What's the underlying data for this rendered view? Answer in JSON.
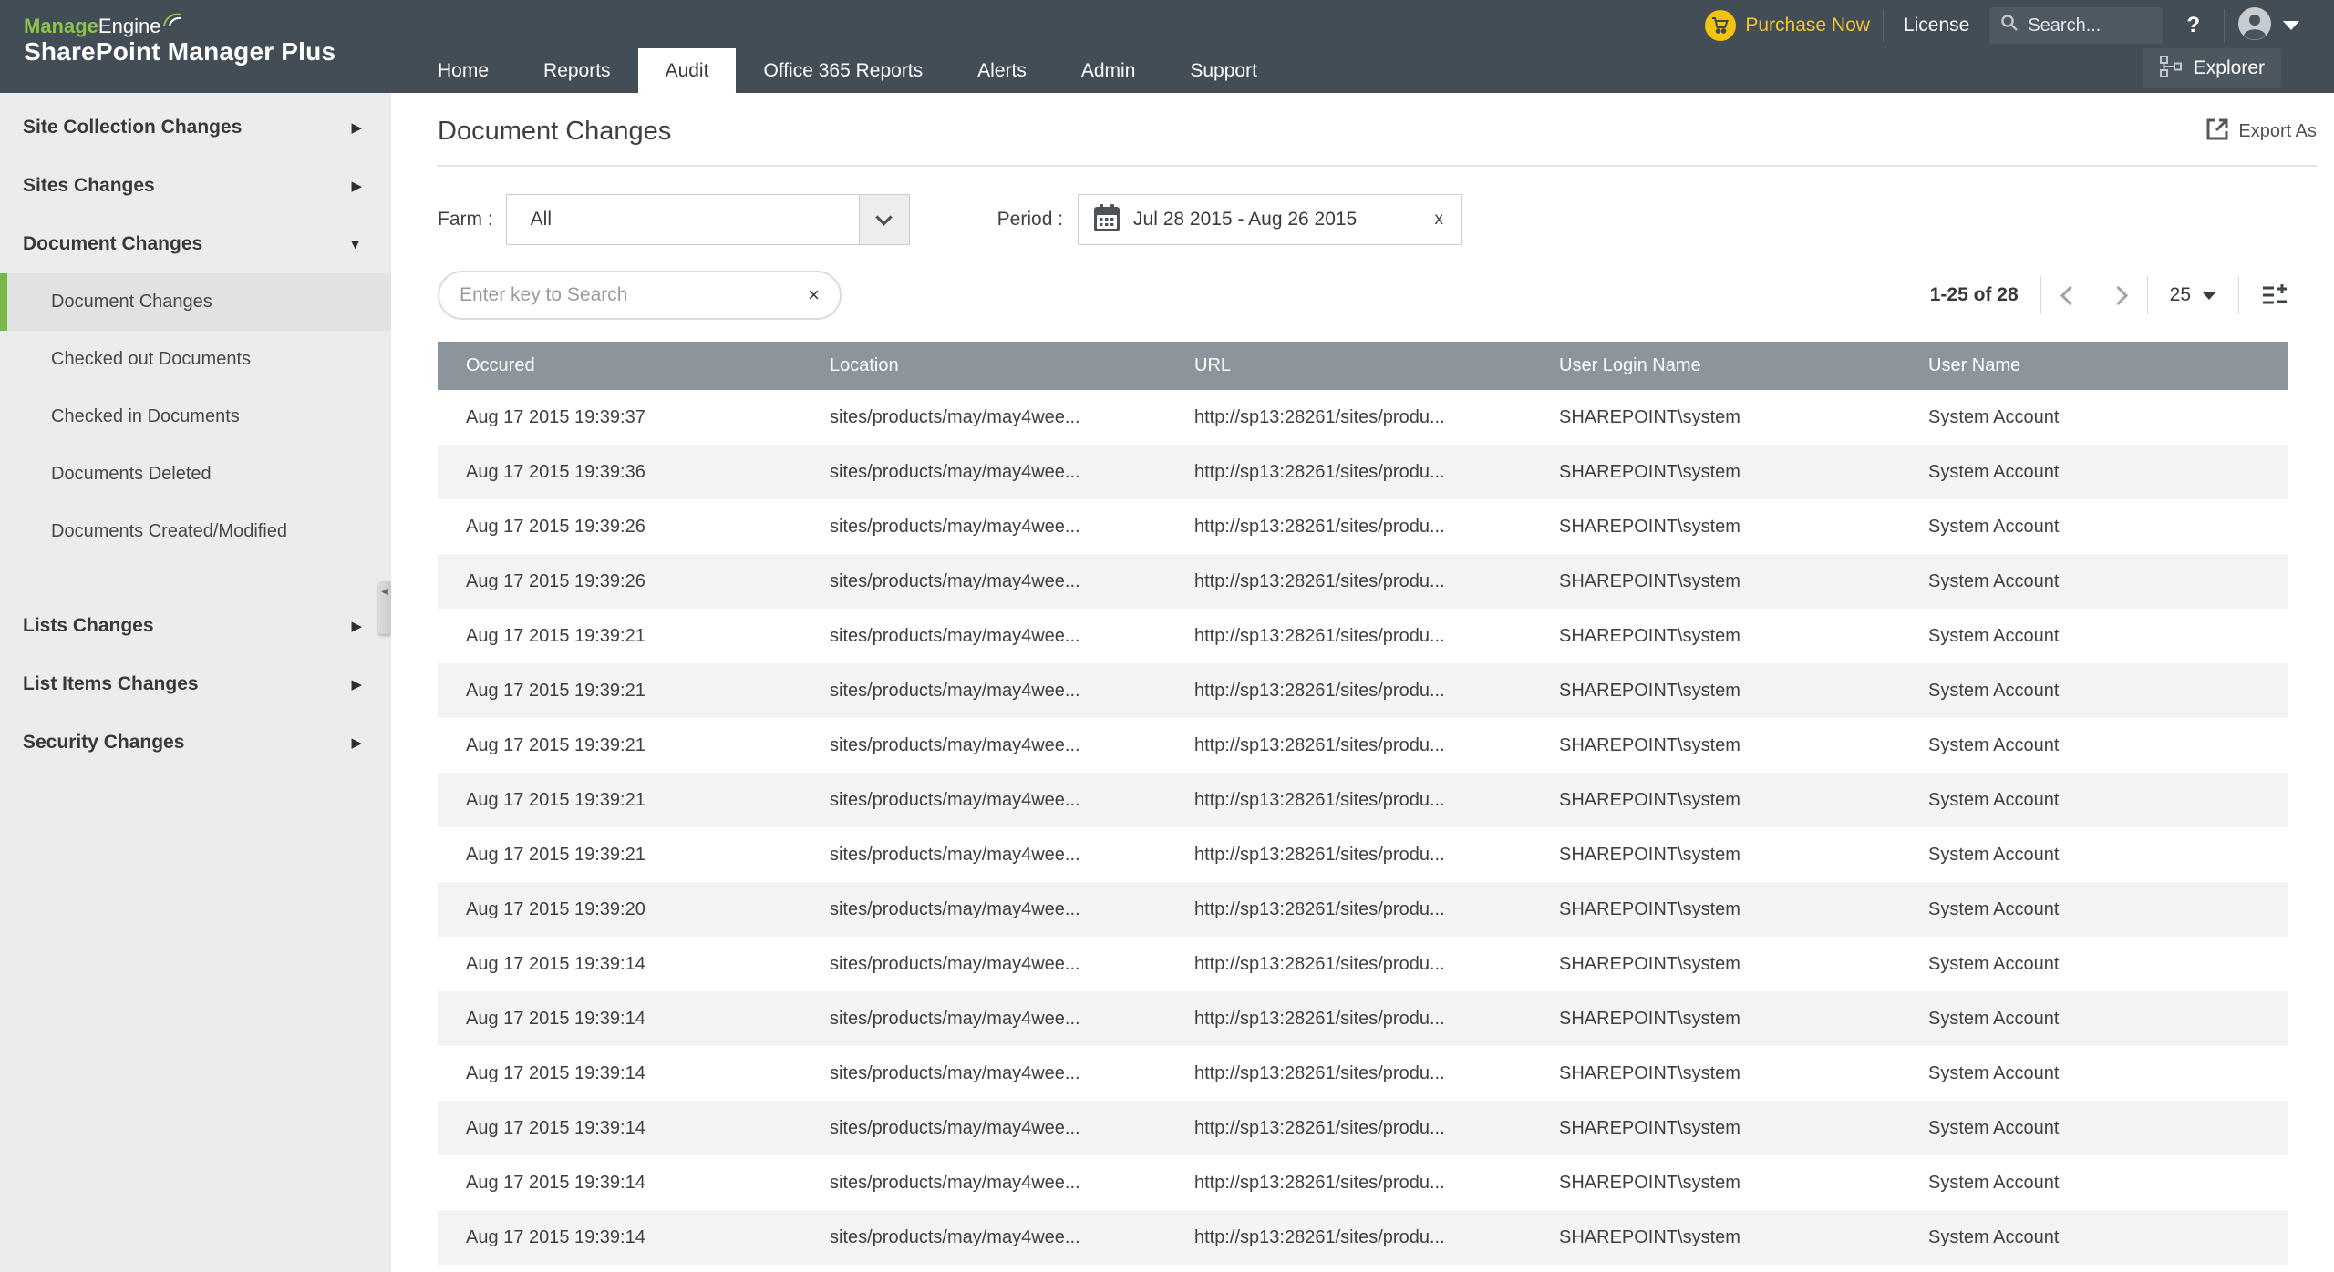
{
  "header": {
    "brand": {
      "manage": "Manage",
      "engine": "Engine",
      "product": "SharePoint Manager Plus"
    },
    "utility": {
      "purchase_label": "Purchase Now",
      "license_label": "License",
      "search_placeholder": "Search...",
      "help_label": "?"
    },
    "nav": [
      {
        "label": "Home",
        "active": false
      },
      {
        "label": "Reports",
        "active": false
      },
      {
        "label": "Audit",
        "active": true
      },
      {
        "label": "Office 365 Reports",
        "active": false
      },
      {
        "label": "Alerts",
        "active": false
      },
      {
        "label": "Admin",
        "active": false
      },
      {
        "label": "Support",
        "active": false
      }
    ],
    "explorer_label": "Explorer"
  },
  "sidebar": {
    "items": [
      {
        "label": "Site Collection Changes",
        "type": "group",
        "state": "collapsed"
      },
      {
        "label": "Sites Changes",
        "type": "group",
        "state": "collapsed"
      },
      {
        "label": "Document Changes",
        "type": "group",
        "state": "expanded"
      },
      {
        "label": "Document Changes",
        "type": "child",
        "selected": true
      },
      {
        "label": "Checked out Documents",
        "type": "child",
        "selected": false
      },
      {
        "label": "Checked in Documents",
        "type": "child",
        "selected": false
      },
      {
        "label": "Documents Deleted",
        "type": "child",
        "selected": false
      },
      {
        "label": "Documents Created/Modified",
        "type": "child",
        "selected": false
      },
      {
        "label": "Lists Changes",
        "type": "group",
        "state": "collapsed",
        "gap": true
      },
      {
        "label": "List Items Changes",
        "type": "group",
        "state": "collapsed"
      },
      {
        "label": "Security Changes",
        "type": "group",
        "state": "collapsed"
      }
    ]
  },
  "main": {
    "title": "Document Changes",
    "export_label": "Export As",
    "filters": {
      "farm_label": "Farm :",
      "farm_value": "All",
      "period_label": "Period :",
      "period_value": "Jul 28 2015 - Aug 26 2015",
      "period_clear": "x"
    },
    "toolbar": {
      "search_placeholder": "Enter key to Search",
      "search_clear": "×",
      "range": "1-25 of 28",
      "page_size": "25"
    },
    "table": {
      "columns": [
        "Occured",
        "Location",
        "URL",
        "User Login Name",
        "User Name"
      ],
      "rows": [
        [
          "Aug 17 2015 19:39:37",
          "sites/products/may/may4wee...",
          "http://sp13:28261/sites/produ...",
          "SHAREPOINT\\system",
          "System Account"
        ],
        [
          "Aug 17 2015 19:39:36",
          "sites/products/may/may4wee...",
          "http://sp13:28261/sites/produ...",
          "SHAREPOINT\\system",
          "System Account"
        ],
        [
          "Aug 17 2015 19:39:26",
          "sites/products/may/may4wee...",
          "http://sp13:28261/sites/produ...",
          "SHAREPOINT\\system",
          "System Account"
        ],
        [
          "Aug 17 2015 19:39:26",
          "sites/products/may/may4wee...",
          "http://sp13:28261/sites/produ...",
          "SHAREPOINT\\system",
          "System Account"
        ],
        [
          "Aug 17 2015 19:39:21",
          "sites/products/may/may4wee...",
          "http://sp13:28261/sites/produ...",
          "SHAREPOINT\\system",
          "System Account"
        ],
        [
          "Aug 17 2015 19:39:21",
          "sites/products/may/may4wee...",
          "http://sp13:28261/sites/produ...",
          "SHAREPOINT\\system",
          "System Account"
        ],
        [
          "Aug 17 2015 19:39:21",
          "sites/products/may/may4wee...",
          "http://sp13:28261/sites/produ...",
          "SHAREPOINT\\system",
          "System Account"
        ],
        [
          "Aug 17 2015 19:39:21",
          "sites/products/may/may4wee...",
          "http://sp13:28261/sites/produ...",
          "SHAREPOINT\\system",
          "System Account"
        ],
        [
          "Aug 17 2015 19:39:21",
          "sites/products/may/may4wee...",
          "http://sp13:28261/sites/produ...",
          "SHAREPOINT\\system",
          "System Account"
        ],
        [
          "Aug 17 2015 19:39:20",
          "sites/products/may/may4wee...",
          "http://sp13:28261/sites/produ...",
          "SHAREPOINT\\system",
          "System Account"
        ],
        [
          "Aug 17 2015 19:39:14",
          "sites/products/may/may4wee...",
          "http://sp13:28261/sites/produ...",
          "SHAREPOINT\\system",
          "System Account"
        ],
        [
          "Aug 17 2015 19:39:14",
          "sites/products/may/may4wee...",
          "http://sp13:28261/sites/produ...",
          "SHAREPOINT\\system",
          "System Account"
        ],
        [
          "Aug 17 2015 19:39:14",
          "sites/products/may/may4wee...",
          "http://sp13:28261/sites/produ...",
          "SHAREPOINT\\system",
          "System Account"
        ],
        [
          "Aug 17 2015 19:39:14",
          "sites/products/may/may4wee...",
          "http://sp13:28261/sites/produ...",
          "SHAREPOINT\\system",
          "System Account"
        ],
        [
          "Aug 17 2015 19:39:14",
          "sites/products/may/may4wee...",
          "http://sp13:28261/sites/produ...",
          "SHAREPOINT\\system",
          "System Account"
        ],
        [
          "Aug 17 2015 19:39:14",
          "sites/products/may/may4wee...",
          "http://sp13:28261/sites/produ...",
          "SHAREPOINT\\system",
          "System Account"
        ]
      ]
    }
  },
  "icons": {
    "cart": "shopping-cart",
    "search": "magnifier",
    "user": "person-circle",
    "explorer": "sitemap",
    "export": "square-arrow-out",
    "calendar": "calendar-grid",
    "columns": "column-settings",
    "group_collapsed": "▶",
    "group_expanded": "▼",
    "collapse_handle": "◀"
  },
  "colors": {
    "header_bg": "#434d56",
    "brand_green": "#8bc34a",
    "brand_yellow": "#f1c40f",
    "accent_green": "#7bb84c",
    "sidebar_bg": "#ebeced",
    "sidebar_selected_bg": "#e1e2e2",
    "table_header_bg": "#8c949c",
    "row_alt_bg": "#f3f4f4"
  }
}
